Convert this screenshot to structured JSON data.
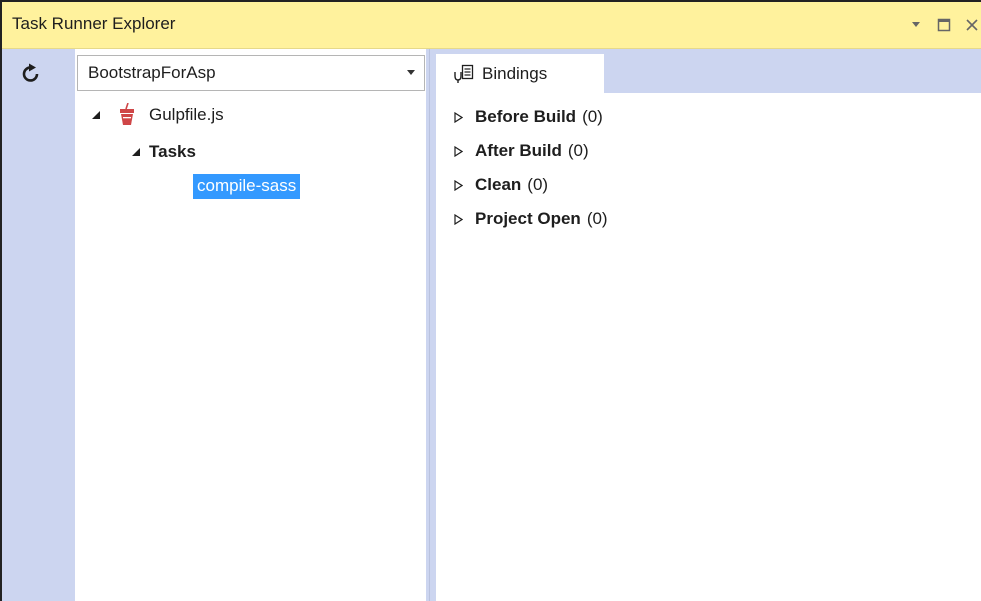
{
  "window": {
    "title": "Task Runner Explorer",
    "controls": {
      "dropdown_icon": "chevron-down-icon",
      "maximize_icon": "restore-icon",
      "close_icon": "close-icon"
    }
  },
  "toolbar": {
    "refresh_icon": "refresh-icon"
  },
  "project_selector": {
    "value": "BootstrapForAsp"
  },
  "tree": {
    "file": {
      "label": "Gulpfile.js",
      "icon": "gulp-icon"
    },
    "tasks_node": {
      "label": "Tasks"
    },
    "tasks": [
      {
        "label": "compile-sass",
        "selected": true
      }
    ]
  },
  "bindings": {
    "tab_label": "Bindings",
    "items": [
      {
        "name": "Before Build",
        "count": "(0)"
      },
      {
        "name": "After Build",
        "count": "(0)"
      },
      {
        "name": "Clean",
        "count": "(0)"
      },
      {
        "name": "Project Open",
        "count": "(0)"
      }
    ]
  },
  "colors": {
    "title_bar": "#fff29d",
    "tool_strip": "#ccd5f0",
    "selection": "#3399ff",
    "gulp_red": "#cf4647"
  }
}
